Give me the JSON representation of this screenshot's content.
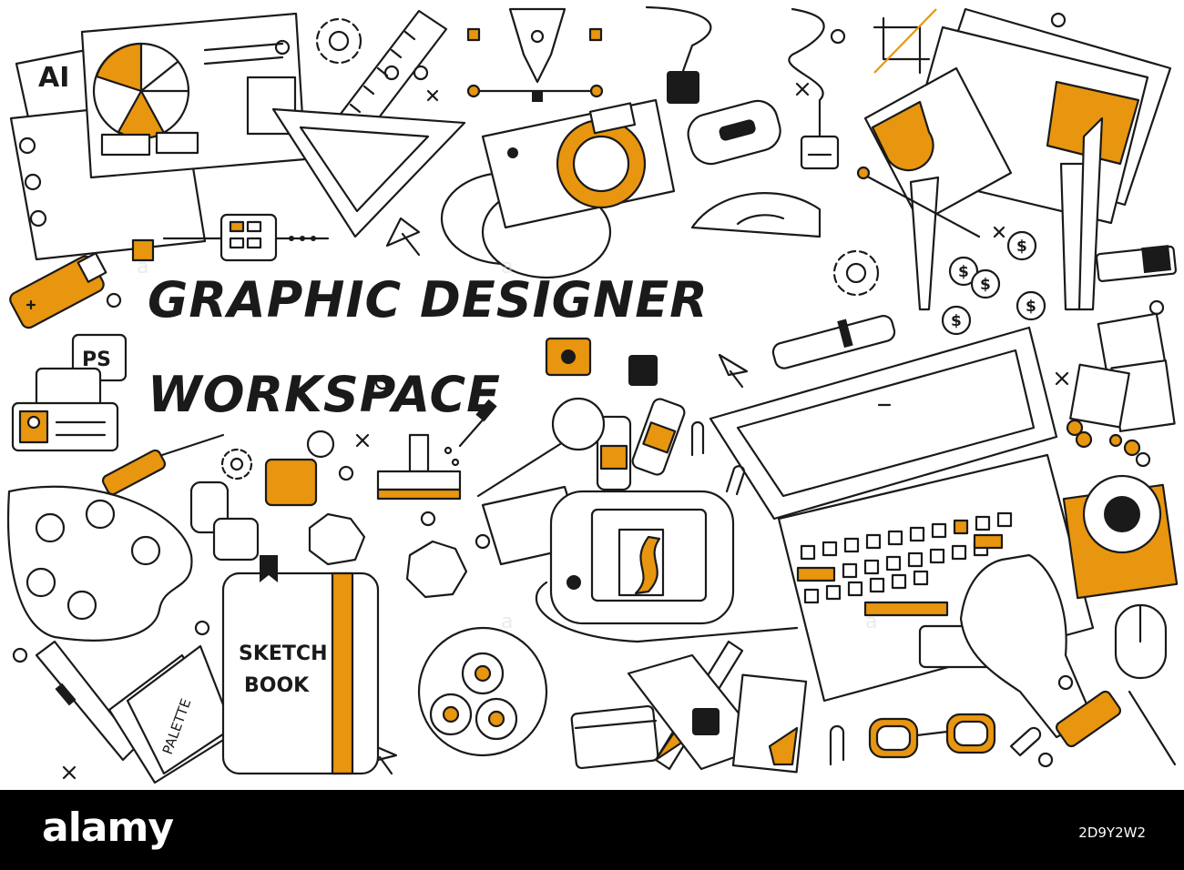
{
  "illustration": {
    "title_line_1": "GRAPHIC DESIGNER",
    "title_line_2": "WORKSPACE",
    "sketchbook_line_1": "SKETCH",
    "sketchbook_line_2": "BOOK",
    "ai_label": "AI",
    "ps_label": "PS",
    "palette_label": "PALETTE",
    "dollar_sign": "$",
    "colors": {
      "accent": "#e8960f",
      "ink": "#1a1a1a",
      "background": "#ffffff"
    }
  },
  "footer": {
    "logo": "alamy",
    "image_id": "2D9Y2W2",
    "background": "#000000"
  }
}
